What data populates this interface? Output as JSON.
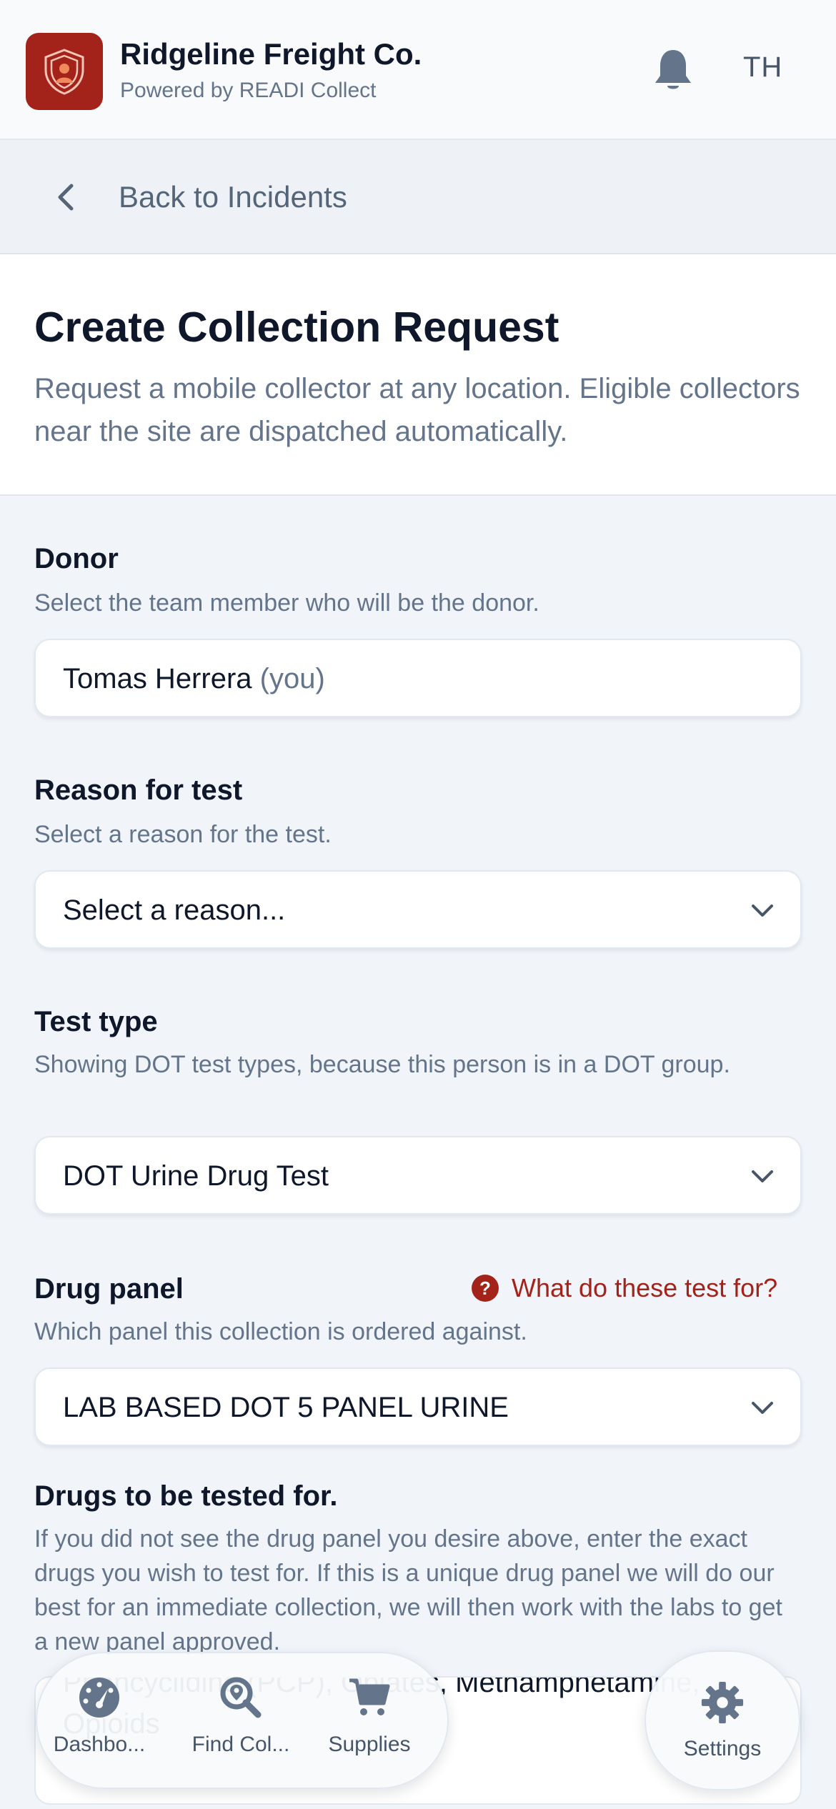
{
  "header": {
    "company": "Ridgeline Freight Co.",
    "subtitle": "Powered by READI Collect",
    "initials": "TH"
  },
  "back": {
    "label": "Back to Incidents"
  },
  "page": {
    "title": "Create Collection Request",
    "subtitle": "Request a mobile collector at any location. Eligible collectors near the site are dispatched automatically."
  },
  "donor": {
    "label": "Donor",
    "help": "Select the team member who will be the donor.",
    "value": "Tomas Herrera",
    "suffix": "(you)"
  },
  "reason": {
    "label": "Reason for test",
    "help": "Select a reason for the test.",
    "placeholder": "Select a reason..."
  },
  "test_type": {
    "label": "Test type",
    "help": "Showing DOT test types, because this person is in a DOT group.",
    "value": "DOT Urine Drug Test"
  },
  "drug_panel": {
    "label": "Drug panel",
    "help_link": "What do these test for?",
    "help": "Which panel this collection is ordered against.",
    "value": "LAB BASED DOT 5 PANEL URINE"
  },
  "drugs": {
    "label": "Drugs to be tested for.",
    "help": "If you did not see the drug panel you desire above, enter the exact drugs you wish to test for. If this is a unique drug panel we will do our best for an immediate collection, we will then work with the labs to get a new panel approved.",
    "value": "Amphetamines, Cocaine, Marijuana (THC), Phencyclidine (PCP), Opiates, Methamphetamine, Opioids"
  },
  "nav": {
    "items": [
      {
        "label": "Dashbo...",
        "icon": "dashboard-icon"
      },
      {
        "label": "Find Col...",
        "icon": "find-location-icon"
      },
      {
        "label": "Supplies",
        "icon": "cart-icon"
      }
    ],
    "settings": {
      "label": "Settings",
      "icon": "gear-icon"
    }
  },
  "colors": {
    "brand": "#a3231b",
    "text": "#0f172a",
    "muted": "#64748b"
  }
}
